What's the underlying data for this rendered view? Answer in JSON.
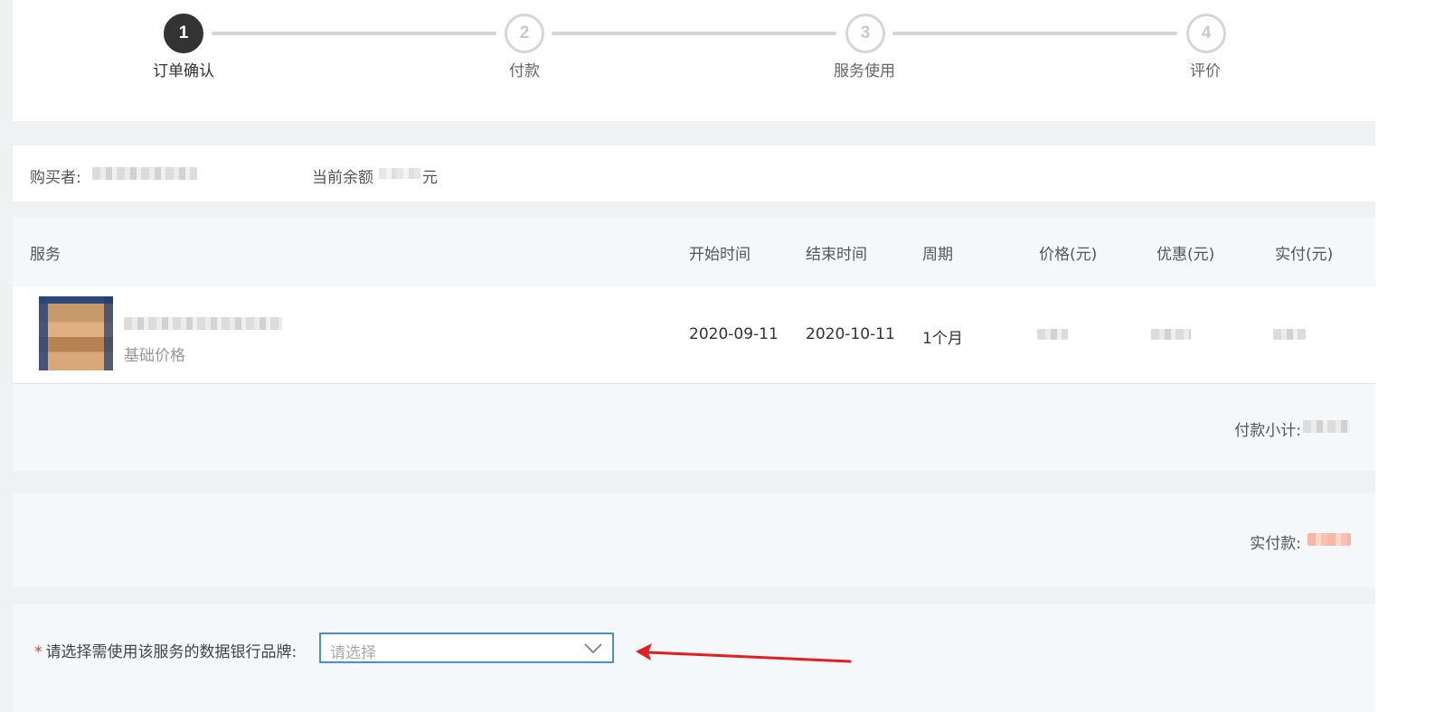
{
  "steps": [
    {
      "number": "1",
      "label": "订单确认",
      "active": true
    },
    {
      "number": "2",
      "label": "付款",
      "active": false
    },
    {
      "number": "3",
      "label": "服务使用",
      "active": false
    },
    {
      "number": "4",
      "label": "评价",
      "active": false
    }
  ],
  "buyer": {
    "buyer_label": "购买者:",
    "balance_label": "当前余额",
    "balance_unit": "元"
  },
  "table": {
    "headers": {
      "service": "服务",
      "start": "开始时间",
      "end": "结束时间",
      "period": "周期",
      "price": "价格(元)",
      "discount": "优惠(元)",
      "paid": "实付(元)"
    },
    "row": {
      "service_subtitle": "基础价格",
      "start": "2020-09-11",
      "end": "2020-10-11",
      "period": "1个月"
    },
    "subtotal_label": "付款小计:"
  },
  "payment": {
    "label": "实付款:"
  },
  "brand_select": {
    "required_mark": "*",
    "label": "请选择需使用该服务的数据银行品牌:",
    "placeholder": "请选择"
  },
  "colors": {
    "active_step": "#333333",
    "inactive_step": "#d6d6d6",
    "select_border": "#4a90c8",
    "required": "#e23b3b",
    "annotation_arrow": "#e02020"
  }
}
